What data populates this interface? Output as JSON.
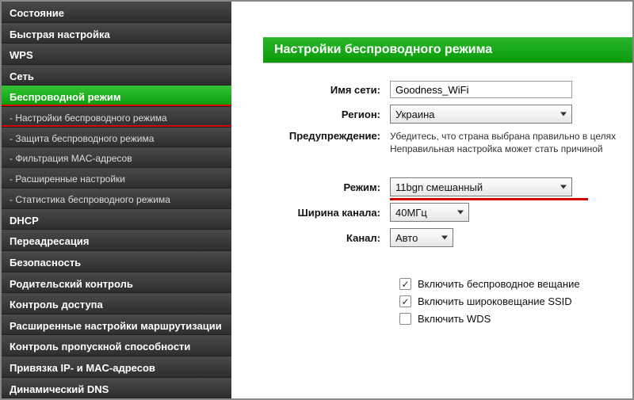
{
  "sidebar": {
    "items": [
      {
        "label": "Состояние"
      },
      {
        "label": "Быстрая настройка"
      },
      {
        "label": "WPS"
      },
      {
        "label": "Сеть"
      },
      {
        "label": "Беспроводной режим"
      },
      {
        "label": "DHCP"
      },
      {
        "label": "Переадресация"
      },
      {
        "label": "Безопасность"
      },
      {
        "label": "Родительский контроль"
      },
      {
        "label": "Контроль доступа"
      },
      {
        "label": "Расширенные настройки маршрутизации"
      },
      {
        "label": "Контроль пропускной способности"
      },
      {
        "label": "Привязка IP- и MAC-адресов"
      },
      {
        "label": "Динамический DNS"
      }
    ],
    "wireless_sub": [
      {
        "label": "- Настройки беспроводного режима"
      },
      {
        "label": "- Защита беспроводного режима"
      },
      {
        "label": "- Фильтрация MAC-адресов"
      },
      {
        "label": "- Расширенные настройки"
      },
      {
        "label": "- Статистика беспроводного режима"
      }
    ]
  },
  "panel": {
    "title": "Настройки беспроводного режима",
    "fields": {
      "ssid_label": "Имя сети:",
      "ssid_value": "Goodness_WiFi",
      "region_label": "Регион:",
      "region_value": "Украина",
      "warn_label": "Предупреждение:",
      "warn_text1": "Убедитесь, что страна выбрана правильно в целях",
      "warn_text2": "Неправильная настройка может стать причиной",
      "mode_label": "Режим:",
      "mode_value": "11bgn смешанный",
      "chwidth_label": "Ширина канала:",
      "chwidth_value": "40МГц",
      "channel_label": "Канал:",
      "channel_value": "Авто"
    },
    "checks": {
      "broadcast_label": "Включить беспроводное вещание",
      "broadcast_checked": true,
      "ssidbc_label": "Включить широковещание SSID",
      "ssidbc_checked": true,
      "wds_label": "Включить WDS",
      "wds_checked": false
    }
  }
}
